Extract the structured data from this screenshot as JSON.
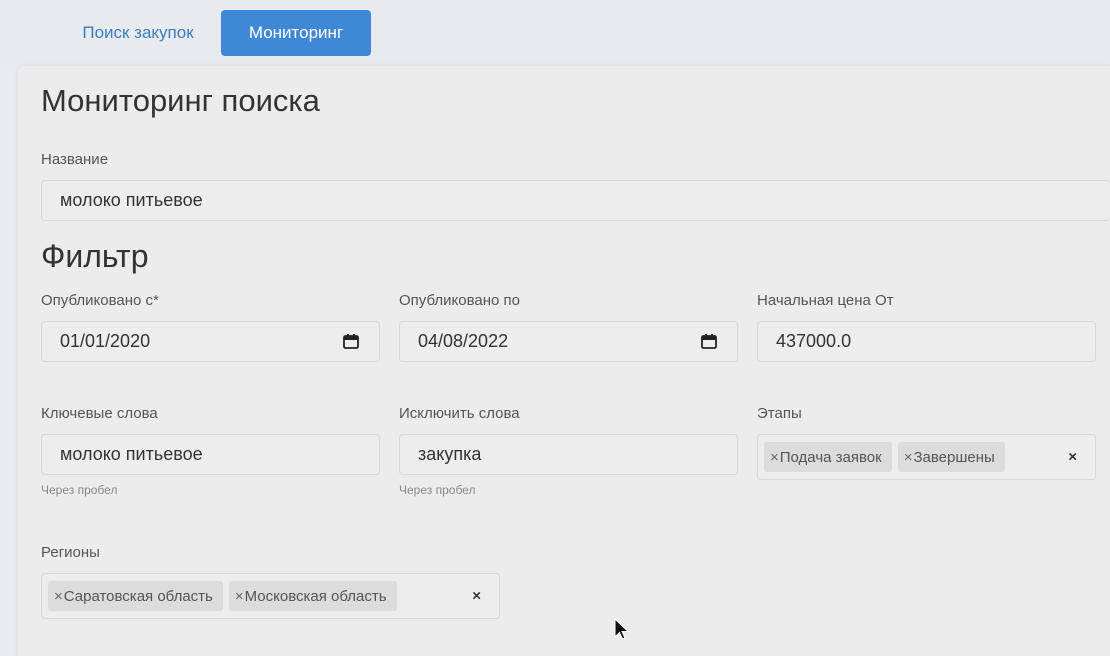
{
  "nav": {
    "tabs": [
      {
        "label": "Поиск закупок",
        "active": false
      },
      {
        "label": "Мониторинг",
        "active": true
      }
    ]
  },
  "page_title": "Мониторинг поиска",
  "name_field": {
    "label": "Название",
    "value": "молоко питьевое"
  },
  "filter": {
    "title": "Фильтр",
    "published_from": {
      "label": "Опубликовано с*",
      "value": "01/01/2020",
      "icon": "calendar-icon"
    },
    "published_to": {
      "label": "Опубликовано по",
      "value": "04/08/2022",
      "icon": "calendar-icon"
    },
    "start_price": {
      "label": "Начальная цена От",
      "value": "437000.0"
    },
    "keywords": {
      "label": "Ключевые слова",
      "value": "молоко питьевое",
      "hint": "Через пробел"
    },
    "exclude_words": {
      "label": "Исключить слова",
      "value": "закупка",
      "hint": "Через пробел"
    },
    "stages": {
      "label": "Этапы",
      "chips": [
        "Подача заявок",
        "Завершены"
      ],
      "chip_remove": "×",
      "clear": "×"
    },
    "regions": {
      "label": "Регионы",
      "chips": [
        "Саратовская область",
        "Московская область"
      ],
      "chip_remove": "×",
      "clear": "×"
    }
  },
  "colors": {
    "accent": "#3f88d6",
    "link": "#3c7fbf",
    "background": "#ececec"
  }
}
